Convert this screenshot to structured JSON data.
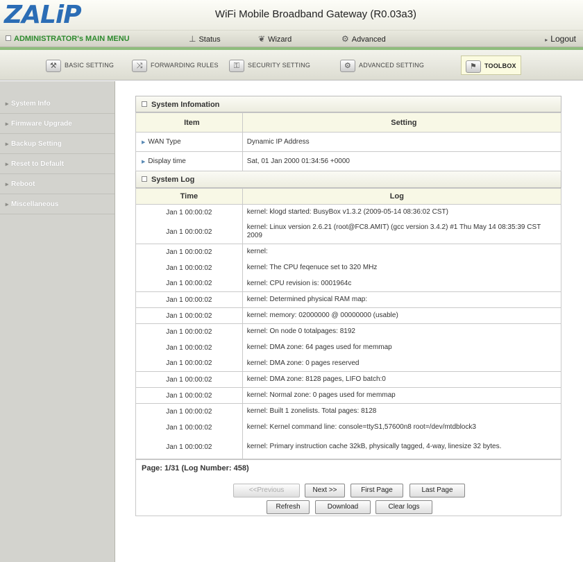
{
  "header": {
    "logo": "ZALiP",
    "title": "WiFi Mobile Broadband Gateway (R0.03a3)"
  },
  "topmenu": {
    "admin": "ADMINISTRATOR's MAIN MENU",
    "status": "Status",
    "wizard": "Wizard",
    "advanced": "Advanced",
    "logout": "Logout"
  },
  "tabs": [
    {
      "label": "BASIC SETTING",
      "icon": "basic-setting-icon"
    },
    {
      "label": "FORWARDING RULES",
      "icon": "forwarding-icon"
    },
    {
      "label": "SECURITY SETTING",
      "icon": "security-icon"
    },
    {
      "label": "ADVANCED SETTING",
      "icon": "advanced-setting-icon"
    },
    {
      "label": "TOOLBOX",
      "icon": "toolbox-icon",
      "active": true
    }
  ],
  "sidebar": {
    "items": [
      {
        "label": "System Info"
      },
      {
        "label": "Firmware Upgrade"
      },
      {
        "label": "Backup Setting"
      },
      {
        "label": "Reset to Default"
      },
      {
        "label": "Reboot"
      },
      {
        "label": "Miscellaneous"
      }
    ]
  },
  "sysinfo": {
    "title": "System Infomation",
    "col_item": "Item",
    "col_setting": "Setting",
    "rows": [
      {
        "item": "WAN Type",
        "value": "Dynamic IP Address"
      },
      {
        "item": "Display time",
        "value": "Sat, 01 Jan 2000 01:34:56 +0000"
      }
    ]
  },
  "syslog": {
    "title": "System Log",
    "col_time": "Time",
    "col_log": "Log",
    "rows": [
      {
        "time": "Jan 1 00:00:02",
        "log": "kernel: klogd started: BusyBox v1.3.2 (2009-05-14 08:36:02 CST)"
      },
      {
        "time": "Jan 1 00:00:02",
        "log": "kernel: Linux version 2.6.21 (root@FC8.AMIT) (gcc version 3.4.2) #1 Thu May 14 08:35:39 CST 2009"
      },
      {
        "time": "Jan 1 00:00:02",
        "log": "kernel:"
      },
      {
        "time": "Jan 1 00:00:02",
        "log": "kernel: The CPU feqenuce set to 320 MHz"
      },
      {
        "time": "Jan 1 00:00:02",
        "log": "kernel: CPU revision is: 0001964c"
      },
      {
        "time": "Jan 1 00:00:02",
        "log": "kernel: Determined physical RAM map:"
      },
      {
        "time": "Jan 1 00:00:02",
        "log": "kernel: memory: 02000000 @ 00000000 (usable)"
      },
      {
        "time": "Jan 1 00:00:02",
        "log": "kernel: On node 0 totalpages: 8192"
      },
      {
        "time": "Jan 1 00:00:02",
        "log": "kernel: DMA zone: 64 pages used for memmap"
      },
      {
        "time": "Jan 1 00:00:02",
        "log": "kernel: DMA zone: 0 pages reserved"
      },
      {
        "time": "Jan 1 00:00:02",
        "log": "kernel: DMA zone: 8128 pages, LIFO batch:0"
      },
      {
        "time": "Jan 1 00:00:02",
        "log": "kernel: Normal zone: 0 pages used for memmap"
      },
      {
        "time": "Jan 1 00:00:02",
        "log": "kernel: Built 1 zonelists. Total pages: 8128"
      },
      {
        "time": "Jan 1 00:00:02",
        "log": "kernel: Kernel command line: console=ttyS1,57600n8 root=/dev/mtdblock3"
      },
      {
        "time": "Jan 1 00:00:02",
        "log": "kernel: Primary instruction cache 32kB, physically tagged, 4-way, linesize 32 bytes."
      }
    ],
    "page_info": "Page: 1/31 (Log Number: 458)",
    "buttons": {
      "previous": "<<Previous",
      "next": "Next >>",
      "first": "First Page",
      "last": "Last Page",
      "refresh": "Refresh",
      "download": "Download",
      "clear": "Clear logs"
    }
  }
}
